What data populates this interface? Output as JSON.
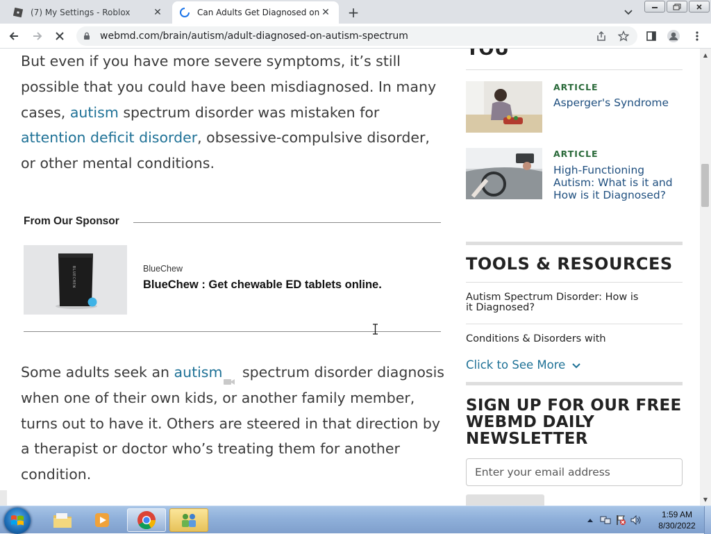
{
  "browser": {
    "tabs": [
      {
        "title": "(7) My Settings - Roblox",
        "active": false
      },
      {
        "title": "Can Adults Get Diagnosed on th",
        "active": true
      }
    ],
    "url": "webmd.com/brain/autism/adult-diagnosed-on-autism-spectrum"
  },
  "article": {
    "para1": {
      "t1": "But even if you have more severe symptoms, it’s still possible that you could have been misdiagnosed. In many cases, ",
      "link1": "autism",
      "t2": " spectrum disorder was mistaken for ",
      "link2": "attention deficit disorder",
      "t3": ", obsessive-compulsive disorder, or other mental conditions."
    },
    "sponsor": {
      "heading": "From Our Sponsor",
      "brand": "BlueChew",
      "title": "BlueChew : Get chewable ED tablets online.",
      "pack_text": "BLUECHEW"
    },
    "para2": {
      "t1": "Some adults seek an ",
      "link1": "autism",
      "t2": " spectrum disorder diagnosis when one of their own kids, or another family member, turns out to have it. Others are steered in that direction by a therapist or doctor who’s treating them for another condition."
    }
  },
  "sidebar": {
    "section_heading_fragment": "YOU",
    "articles": [
      {
        "tag": "ARTICLE",
        "title": "Asperger's Syndrome"
      },
      {
        "tag": "ARTICLE",
        "title": "High-Functioning Autism: What is it and How is it Diagnosed?"
      }
    ],
    "tools_heading": "TOOLS & RESOURCES",
    "tools_items": [
      "Autism Spectrum Disorder: How is it Diagnosed?",
      "Conditions & Disorders with"
    ],
    "see_more": "Click to See More",
    "signup_heading": "SIGN UP FOR OUR FREE WEBMD DAILY NEWSLETTER",
    "email_placeholder": "Enter your email address"
  },
  "taskbar": {
    "time": "1:59 AM",
    "date": "8/30/2022"
  }
}
